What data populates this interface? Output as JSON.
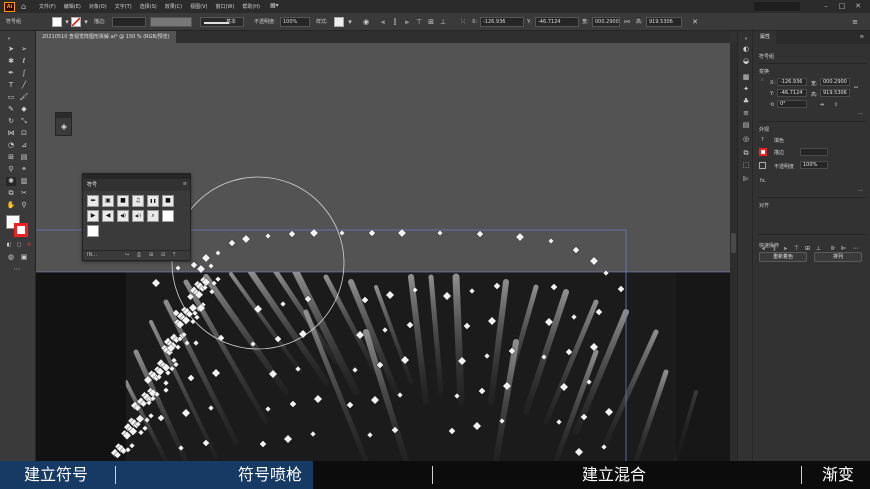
{
  "app": {
    "logo": "Ai",
    "menus": [
      "文件(F)",
      "编辑(E)",
      "对象(O)",
      "文字(T)",
      "选择(S)",
      "效果(C)",
      "视图(V)",
      "窗口(W)",
      "帮助(H)"
    ],
    "window_controls": [
      "–",
      "□",
      "✕"
    ]
  },
  "control_bar": {
    "selection_label": "符号组",
    "stroke_label": "描边:",
    "stroke_style": "基本",
    "opacity_label": "不透明度:",
    "opacity_value": "100%",
    "style_label": "样式:",
    "x_label": "X:",
    "x_value": "-126.936",
    "y_label": "Y:",
    "y_value": "-46.7124",
    "w_label": "宽:",
    "w_value": "000.2900",
    "h_label": "高:",
    "h_value": "919.5306"
  },
  "document": {
    "tab_title": "20210510 查视觉阵图形拆解.ai* @ 150 % (RGB/预览)"
  },
  "properties": {
    "tab": "属性",
    "section_symbol_group": "符号组",
    "section_transform": "变换",
    "x_label": "X:",
    "x_value": "-126.936",
    "y_label": "Y:",
    "y_value": "-46.7124",
    "w_label": "宽:",
    "w_value": "000.2900",
    "h_label": "高:",
    "h_value": "919.5306",
    "rotate_value": "0°",
    "section_appearance": "外观",
    "fill_label": "填色",
    "stroke_label": "描边",
    "opacity_label": "不透明度",
    "opacity_value": "100%",
    "fx_label": "fx.",
    "section_align": "对齐",
    "section_quick_actions": "快速操作",
    "recolor_button": "重新着色",
    "arrange_button": "排列"
  },
  "symbols_panel": {
    "title": "符号",
    "menu_glyph": "≡",
    "symbols": [
      "⬅",
      "▣",
      "■",
      "♫",
      "❚❚",
      "■",
      "▶",
      "◀",
      "◀)",
      "◀))",
      "⌕",
      "",
      ""
    ],
    "footer": [
      "IN…",
      "↪",
      "⎙",
      "⊞",
      "⊟",
      "⤒"
    ]
  },
  "captions": [
    "建立符号",
    "符号喷枪",
    "建立混合",
    "渐变"
  ],
  "colors": {
    "caption_highlight": "#163a63",
    "canvas": "#535353",
    "selection_blue": "#5c6bc0"
  }
}
